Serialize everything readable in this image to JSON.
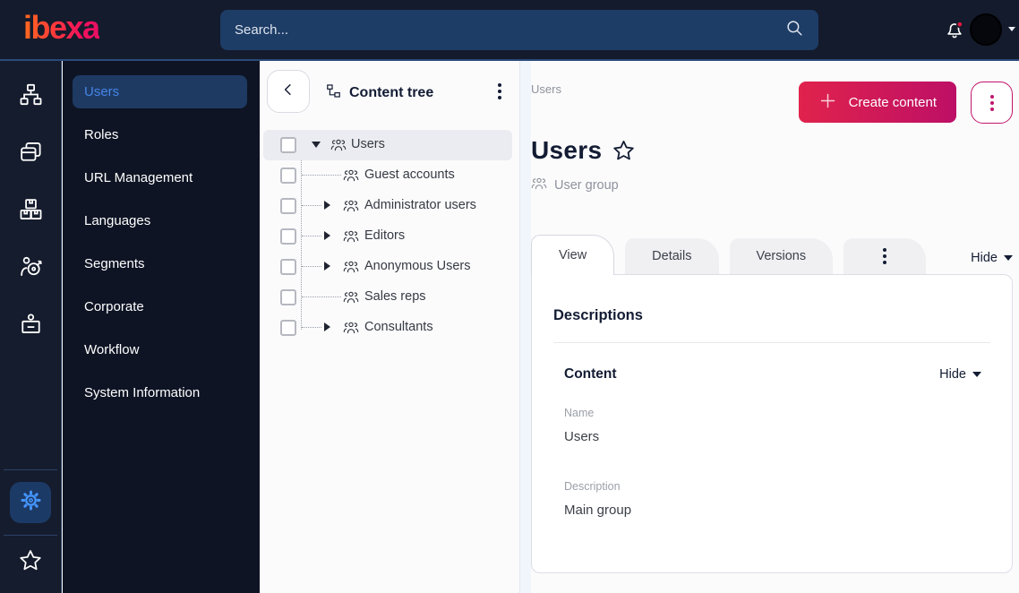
{
  "topbar": {
    "logo": "ibexa",
    "search_placeholder": "Search...",
    "notification_icon": "bell-icon",
    "notification_badge": true,
    "avatar_icon": "avatar-circle"
  },
  "colors": {
    "topbar_bg": "#141b2c",
    "sidebar_bg": "#0e1424",
    "accent_gradient_start": "#e0234c",
    "accent_gradient_end": "#bd0f66",
    "active_item_bg": "#1e3a63",
    "active_item_text": "#4585e6",
    "gear_icon_color": "#4596ff"
  },
  "icon_rail": {
    "top_icons": [
      "sitemap-icon",
      "content-card-icon",
      "modules-icon",
      "personalization-target-icon",
      "corporate-badge-icon"
    ],
    "bottom_icons": [
      "gear-icon",
      "star-icon"
    ]
  },
  "sidebar": {
    "items": [
      {
        "label": "Users",
        "active": true
      },
      {
        "label": "Roles",
        "active": false
      },
      {
        "label": "URL Management",
        "active": false
      },
      {
        "label": "Languages",
        "active": false
      },
      {
        "label": "Segments",
        "active": false
      },
      {
        "label": "Corporate",
        "active": false
      },
      {
        "label": "Workflow",
        "active": false
      },
      {
        "label": "System Information",
        "active": false
      }
    ]
  },
  "content_tree": {
    "title": "Content tree",
    "items": [
      {
        "label": "Users",
        "selected": true,
        "expanded": true,
        "has_children": true
      },
      {
        "label": "Guest accounts",
        "selected": false,
        "expanded": false,
        "has_children": false
      },
      {
        "label": "Administrator users",
        "selected": false,
        "expanded": false,
        "has_children": true
      },
      {
        "label": "Editors",
        "selected": false,
        "expanded": false,
        "has_children": true
      },
      {
        "label": "Anonymous Users",
        "selected": false,
        "expanded": false,
        "has_children": true
      },
      {
        "label": "Sales reps",
        "selected": false,
        "expanded": false,
        "has_children": false
      },
      {
        "label": "Consultants",
        "selected": false,
        "expanded": false,
        "has_children": true
      }
    ]
  },
  "main": {
    "breadcrumb": "Users",
    "create_button_label": "Create content",
    "page_title": "Users",
    "content_type_label": "User group",
    "tabs": [
      {
        "label": "View",
        "active": true
      },
      {
        "label": "Details",
        "active": false
      },
      {
        "label": "Versions",
        "active": false
      }
    ],
    "hide_toggle_label": "Hide",
    "card": {
      "heading": "Descriptions",
      "section": {
        "heading": "Content",
        "toggle_label": "Hide",
        "fields": [
          {
            "label": "Name",
            "value": "Users"
          },
          {
            "label": "Description",
            "value": "Main group"
          }
        ]
      }
    }
  }
}
